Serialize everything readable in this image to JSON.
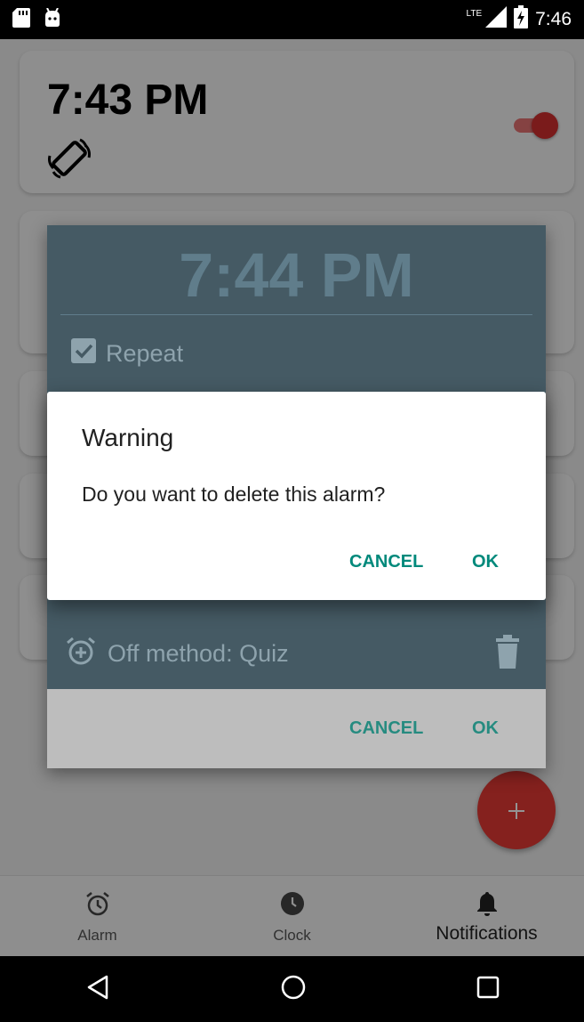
{
  "status_bar": {
    "network": "LTE",
    "time": "7:46"
  },
  "alarms": [
    {
      "time": "7:43 PM",
      "enabled": true,
      "vibrate_icon": "vibrate-icon"
    }
  ],
  "edit_dialog": {
    "time": "7:44 PM",
    "repeat_label": "Repeat",
    "repeat_checked": true,
    "off_method": "Off method: Quiz",
    "cancel_label": "CANCEL",
    "ok_label": "OK"
  },
  "warning_dialog": {
    "title": "Warning",
    "message": "Do you want to delete this alarm?",
    "cancel_label": "CANCEL",
    "ok_label": "OK"
  },
  "fab": {
    "icon": "plus-icon"
  },
  "bottom_nav": [
    {
      "label": "Alarm",
      "icon": "alarm-clock-icon",
      "active": false
    },
    {
      "label": "Clock",
      "icon": "clock-icon",
      "active": false
    },
    {
      "label": "Notifications",
      "icon": "bell-icon",
      "active": true
    }
  ],
  "colors": {
    "accent": "#00897b",
    "alarm_toggle": "#d32f2f",
    "fab": "#e53935",
    "dialog_panel": "#455a64"
  }
}
